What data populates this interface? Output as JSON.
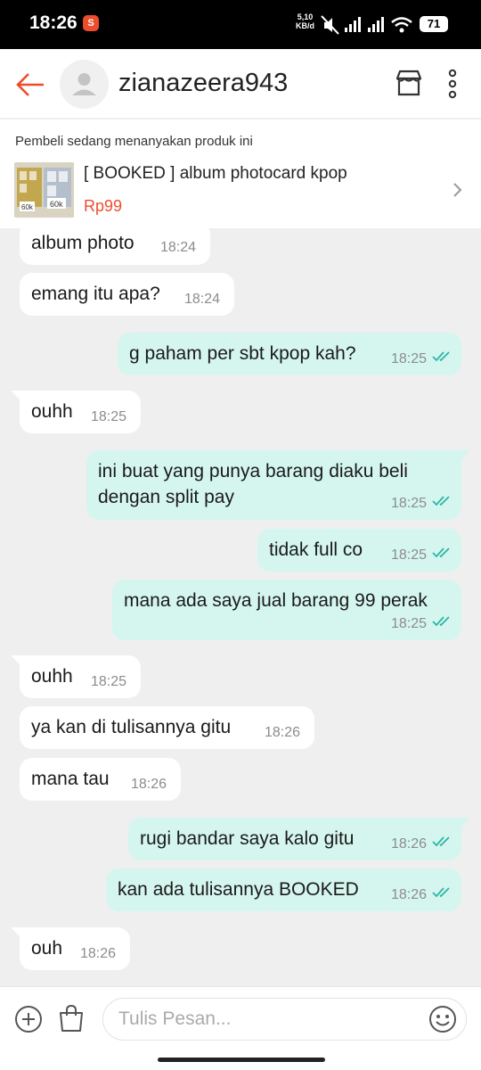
{
  "status_bar": {
    "time": "18:26",
    "speed_value": "5,10",
    "speed_unit": "KB/d",
    "battery": "71"
  },
  "header": {
    "username": "zianazeera943"
  },
  "product": {
    "note": "Pembeli sedang menanyakan produk ini",
    "title": "[ BOOKED ] album photocard kpop",
    "price": "Rp99",
    "thumb_labels": [
      "60k",
      "60k"
    ]
  },
  "messages": [
    {
      "dir": "in",
      "lines": [
        "album photo"
      ],
      "time": "18:24"
    },
    {
      "dir": "in",
      "lines": [
        "emang itu apa?"
      ],
      "time": "18:24"
    },
    {
      "dir": "out",
      "lines": [
        "g paham per sbt kpop kah?"
      ],
      "time": "18:25"
    },
    {
      "dir": "in",
      "lines": [
        "ouhh"
      ],
      "time": "18:25"
    },
    {
      "dir": "out",
      "lines": [
        "ini buat yang punya barang diaku beli",
        "dengan split pay"
      ],
      "time": "18:25"
    },
    {
      "dir": "out",
      "lines": [
        "tidak full co"
      ],
      "time": "18:25"
    },
    {
      "dir": "out",
      "lines": [
        "mana ada saya jual barang 99 perak"
      ],
      "time": "18:25"
    },
    {
      "dir": "in",
      "lines": [
        "ouhh"
      ],
      "time": "18:25"
    },
    {
      "dir": "in",
      "lines": [
        "ya kan di tulisannya gitu"
      ],
      "time": "18:26"
    },
    {
      "dir": "in",
      "lines": [
        "mana tau"
      ],
      "time": "18:26"
    },
    {
      "dir": "out",
      "lines": [
        "rugi bandar saya kalo gitu"
      ],
      "time": "18:26"
    },
    {
      "dir": "out",
      "lines": [
        "kan ada tulisannya BOOKED"
      ],
      "time": "18:26"
    },
    {
      "dir": "in",
      "lines": [
        "ouh"
      ],
      "time": "18:26"
    }
  ],
  "composer": {
    "placeholder": "Tulis Pesan..."
  },
  "colors": {
    "accent": "#ee4d2d",
    "outgoing_bubble": "#d5f6ee",
    "incoming_bubble": "#ffffff",
    "read_ticks": "#2bb5a8"
  },
  "icons": [
    "back-arrow-icon",
    "avatar-placeholder-icon",
    "shop-icon",
    "more-vertical-icon",
    "chevron-right-icon",
    "add-circle-icon",
    "shopping-bag-icon",
    "emoji-icon",
    "read-ticks-icon"
  ]
}
